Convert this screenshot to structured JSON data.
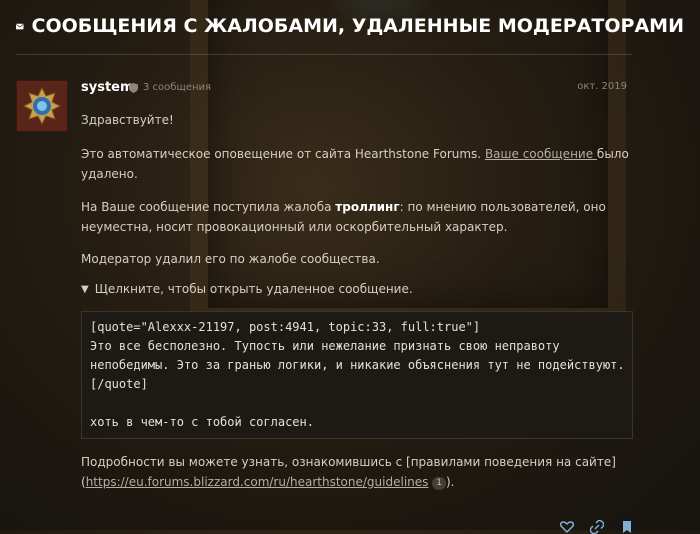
{
  "page": {
    "title": "СООБЩЕНИЯ С ЖАЛОБАМИ, УДАЛЕННЫЕ МОДЕРАТОРАМИ"
  },
  "post": {
    "username": "system",
    "post_count": "3 сообщения",
    "date": "окт. 2019",
    "greeting": "Здравствуйте!",
    "p1_before": "Это автоматическое оповещение от сайта Hearthstone Forums. ",
    "p1_link": "Ваше сообщение ",
    "p1_after": "было удалено.",
    "p2_before": "На Ваше сообщение поступила жалоба ",
    "p2_bold": "троллинг",
    "p2_after": ": по мнению пользователей, оно неуместна, носит провокационный или оскорбительный характер.",
    "p3": "Модератор удалил его по жалобе сообщества.",
    "details_label": "Щелкните, чтобы открыть удаленное сообщение.",
    "code": "[quote=\"Alexxx-21197, post:4941, topic:33, full:true\"]\nЭто все бесполезно. Тупость или нежелание признать свою неправоту\nнепобедимы. Это за гранью логики, и никакие объяснения тут не подействуют.\n[/quote]\n\nхоть в чем-то с тобой согласен.",
    "footer_line1": "Подробности вы можете узнать, ознакомившись с [правилами поведения на сайте]",
    "footer_open": "(",
    "footer_link": "https://eu.forums.blizzard.com/ru/hearthstone/guidelines",
    "footer_badge": "1",
    "footer_close": ")."
  },
  "icons": {
    "title": "envelope-icon",
    "avatar": "hearthstone-logo",
    "role": "shield-icon",
    "actions": [
      "heart-icon",
      "link-icon",
      "bookmark-icon"
    ]
  },
  "colors": {
    "title": "#ffffff",
    "text": "#d7cfc1",
    "muted": "#8f8676",
    "code_bg": "#1d1a15",
    "avatar_bg": "#5a2418"
  }
}
